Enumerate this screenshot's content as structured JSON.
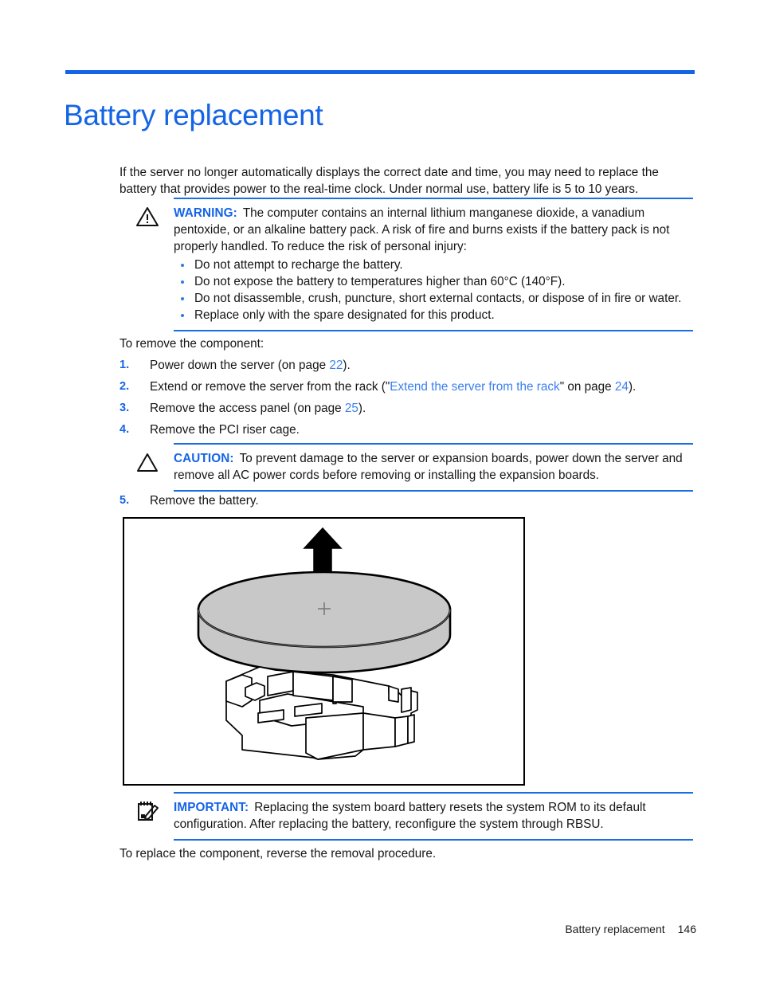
{
  "document": {
    "title": "Battery replacement",
    "accent_color": "#1464e6",
    "link_color": "#3c7ff0",
    "intro": "If the server no longer automatically displays the correct date and time, you may need to replace the battery that provides power to the real-time clock. Under normal use, battery life is 5 to 10 years.",
    "lead_in": "To remove the component:",
    "closing": "To replace the component, reverse the removal procedure."
  },
  "warning": {
    "icon": "warning-triangle-icon",
    "label": "WARNING:",
    "text": "The computer contains an internal lithium manganese dioxide, a vanadium pentoxide, or an alkaline battery pack. A risk of fire and burns exists if the battery pack is not properly handled. To reduce the risk of personal injury:",
    "bullets": [
      "Do not attempt to recharge the battery.",
      "Do not expose the battery to temperatures higher than 60°C (140°F).",
      "Do not disassemble, crush, puncture, short external contacts, or dispose of in fire or water.",
      "Replace only with the spare designated for this product."
    ]
  },
  "caution": {
    "icon": "caution-triangle-icon",
    "label": "CAUTION:",
    "text": "To prevent damage to the server or expansion boards, power down the server and remove all AC power cords before removing or installing the expansion boards."
  },
  "important": {
    "icon": "note-pencil-icon",
    "label": "IMPORTANT:",
    "text": "Replacing the system board battery resets the system ROM to its default configuration. After replacing the battery, reconfigure the system through RBSU."
  },
  "steps": [
    {
      "number": "1.",
      "prefix": "Power down the server (on page ",
      "page_ref": "22",
      "suffix": ")."
    },
    {
      "number": "2.",
      "prefix": "Extend or remove the server from the rack (\"",
      "link": "Extend the server from the rack",
      "middle": "\" on page ",
      "page_ref": "24",
      "suffix": ")."
    },
    {
      "number": "3.",
      "prefix": "Remove the access panel (on page ",
      "page_ref": "25",
      "suffix": ")."
    },
    {
      "number": "4.",
      "prefix": "Remove the PCI riser cage.",
      "page_ref": "",
      "suffix": ""
    },
    {
      "number": "5.",
      "prefix": "Remove the battery.",
      "page_ref": "",
      "suffix": ""
    }
  ],
  "figure": {
    "name": "battery-removal-illustration",
    "description": "Coin cell battery being lifted straight up out of its system board socket, indicated by an upward arrow and dashed centerline.",
    "battery_fill": "#c8c8c8",
    "polarity_mark": "+"
  },
  "footer": {
    "chapter": "Battery replacement",
    "page_number": "146"
  }
}
